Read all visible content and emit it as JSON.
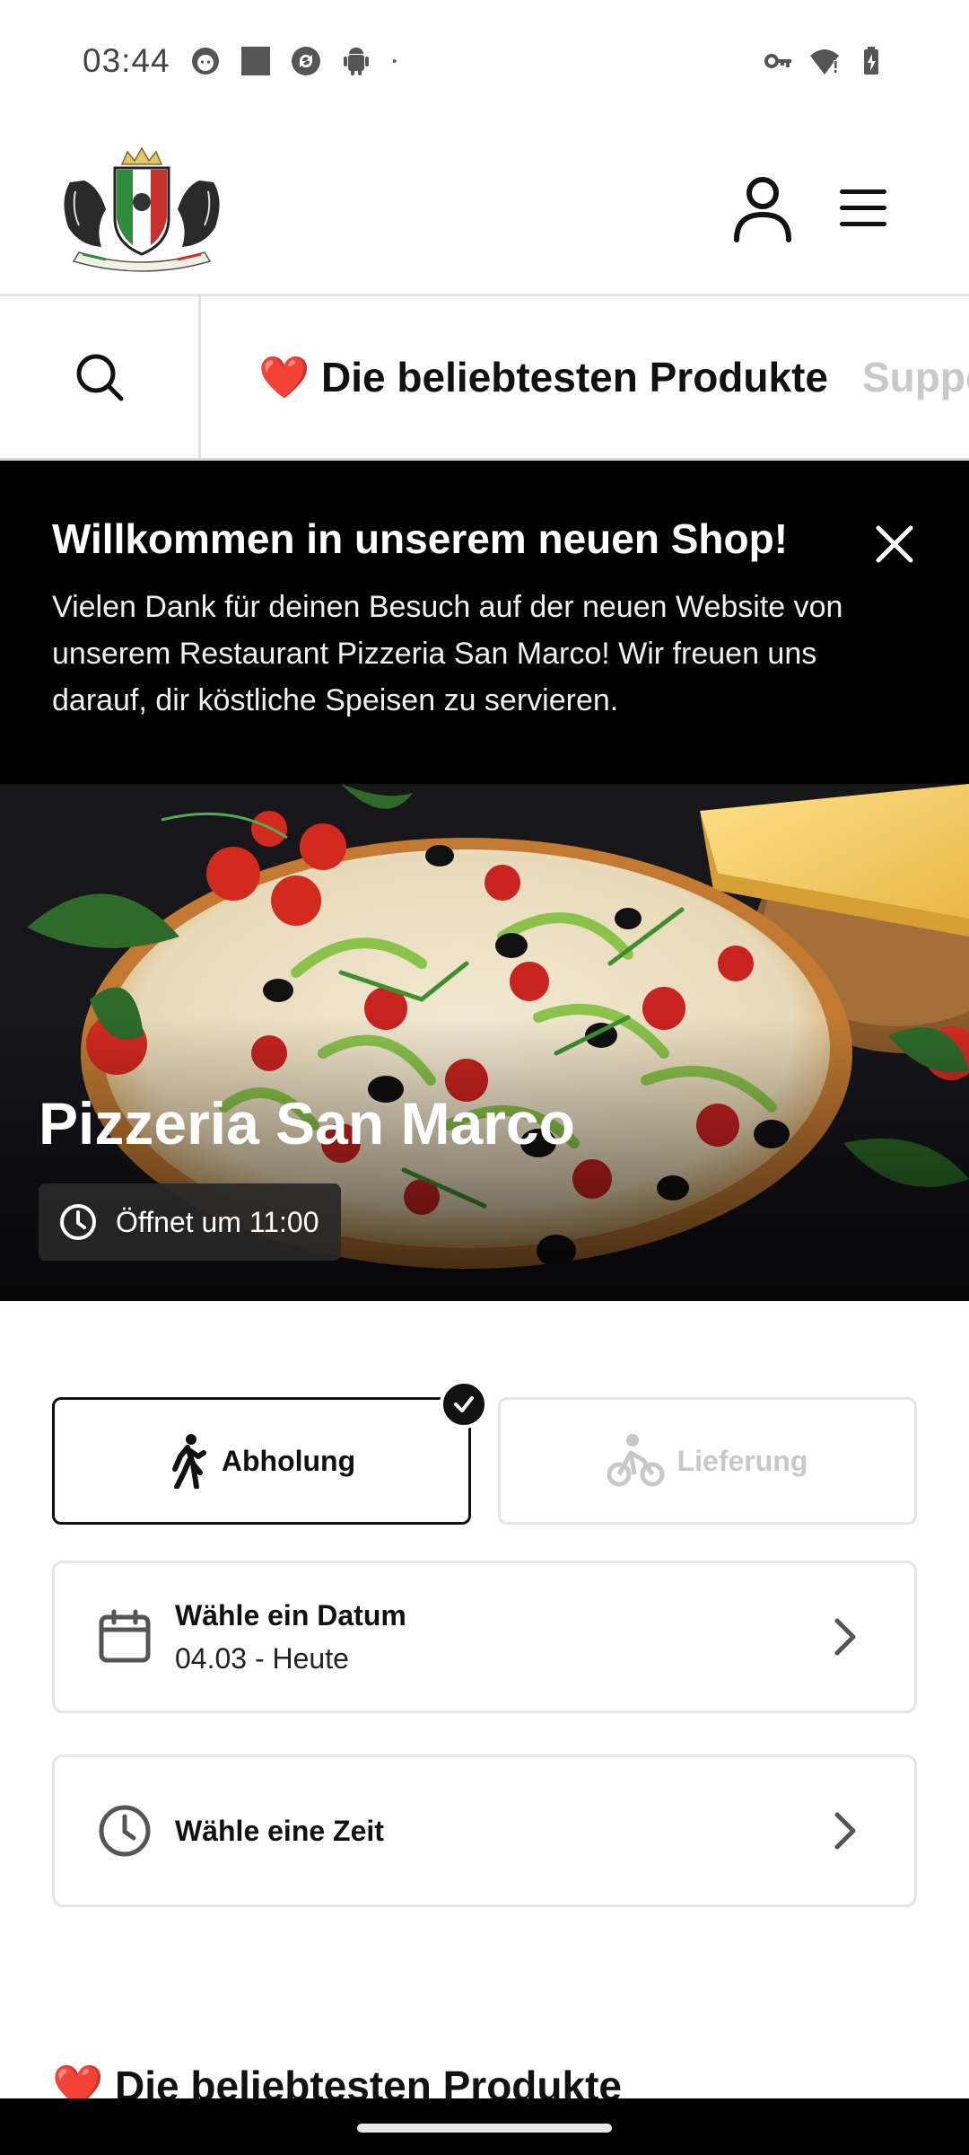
{
  "status_bar": {
    "time": "03:44",
    "left_icons": [
      "face-icon",
      "square-icon",
      "sync-icon",
      "android-icon",
      "dot-icon"
    ],
    "right_icons": [
      "key-icon",
      "wifi-icon",
      "battery-icon"
    ]
  },
  "header": {
    "logo_alt": "Pizzeria San Marco logo",
    "account_icon": "user-icon",
    "menu_icon": "hamburger-icon"
  },
  "categories": {
    "search_icon": "search-icon",
    "items": [
      {
        "label": "❤️ Die beliebtesten Produkte",
        "active": true
      },
      {
        "label": "Suppen",
        "active": false
      }
    ]
  },
  "welcome": {
    "title": "Willkommen in unserem neuen Shop!",
    "text": "Vielen Dank für deinen Besuch auf der neuen Website von unserem Restaurant Pizzeria San Marco! Wir freuen uns darauf, dir köstliche Speisen zu servieren.",
    "close_icon": "close-icon"
  },
  "hero": {
    "restaurant_name": "Pizzeria San Marco",
    "opening_text": "Öffnet um 11:00"
  },
  "order_type": {
    "pickup_label": "Abholung",
    "delivery_label": "Lieferung",
    "selected": "pickup"
  },
  "date_selector": {
    "title": "Wähle ein Datum",
    "value": "04.03 - Heute"
  },
  "time_selector": {
    "title": "Wähle eine Zeit"
  },
  "section": {
    "heading": "❤️ Die beliebtesten Produkte"
  },
  "colors": {
    "primary": "#111111",
    "banner_bg": "#000000",
    "disabled": "#c8c8c8",
    "border": "#e5e5e5",
    "heart": "#d8272b"
  }
}
